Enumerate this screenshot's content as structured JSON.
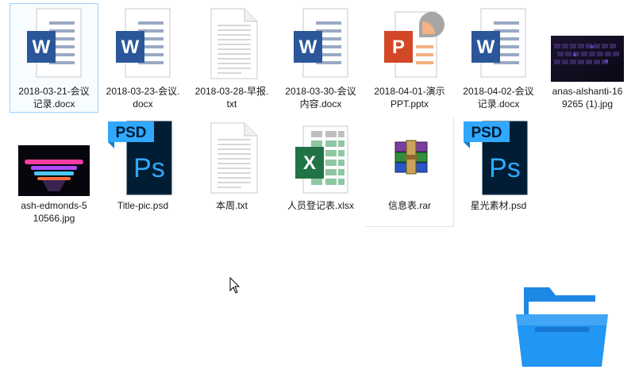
{
  "window": {
    "view": "large-icons"
  },
  "files": [
    {
      "name": "2018-03-21-会议\n记录.docx",
      "type": "word-icon",
      "selected": true
    },
    {
      "name": "2018-03-23-会议.\ndocx",
      "type": "word-icon"
    },
    {
      "name": "2018-03-28-早报.\ntxt",
      "type": "text-file-icon"
    },
    {
      "name": "2018-03-30-会议\n内容.docx",
      "type": "word-icon"
    },
    {
      "name": "2018-04-01-演示\nPPT.pptx",
      "type": "powerpoint-icon"
    },
    {
      "name": "2018-04-02-会议\n记录.docx",
      "type": "word-icon"
    },
    {
      "name": "anas-alshanti-16\n9265 (1).jpg",
      "type": "image-thumbnail"
    },
    {
      "name": "ash-edmonds-5\n10566.jpg",
      "type": "image-thumbnail"
    },
    {
      "name": "Title-pic.psd",
      "type": "photoshop-icon"
    },
    {
      "name": "本周.txt",
      "type": "text-file-icon"
    },
    {
      "name": "人员登记表.xlsx",
      "type": "excel-icon"
    },
    {
      "name": "信息表.rar",
      "type": "winrar-icon"
    },
    {
      "name": "星光素材.psd",
      "type": "photoshop-icon"
    }
  ],
  "icon_labels": {
    "word": "W",
    "powerpoint": "P",
    "excel": "X",
    "psd_badge": "PSD",
    "psd": "Ps"
  },
  "colors": {
    "selection_border": "#99d1ff",
    "word_blue": "#2b579a",
    "ppt_orange": "#d24726",
    "excel_green": "#217346",
    "psd_navy": "#001d34",
    "psd_cyan": "#31a8ff",
    "folder_blue": "#2196f3"
  }
}
